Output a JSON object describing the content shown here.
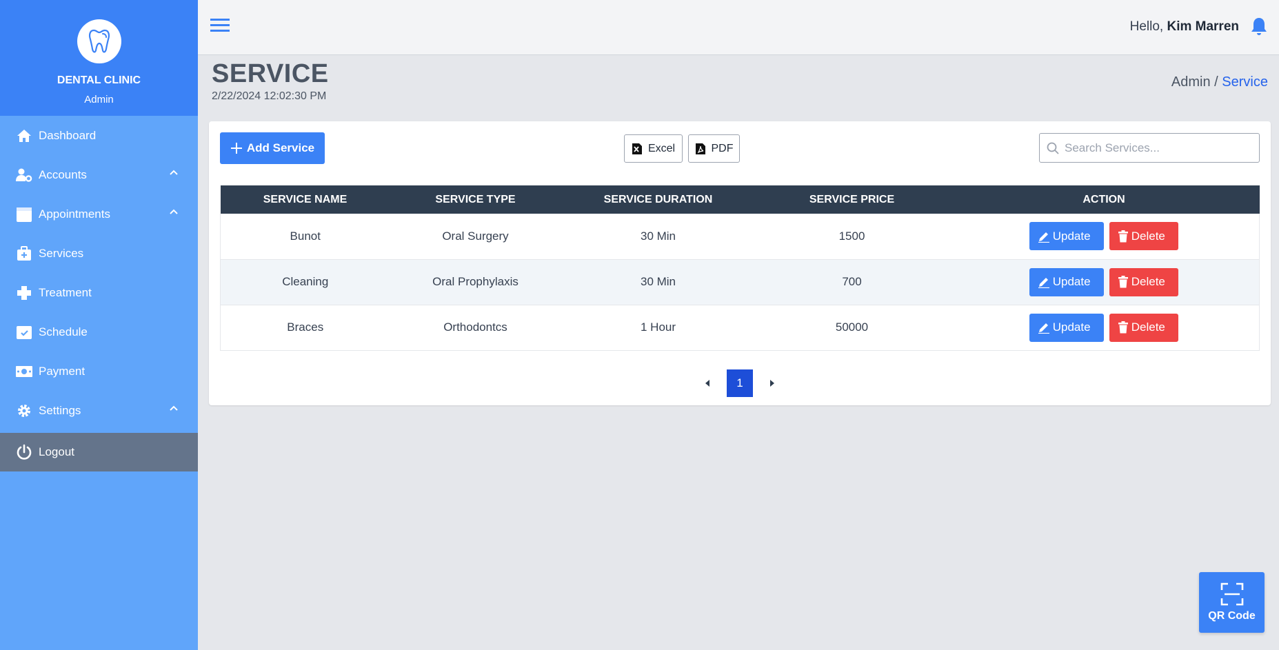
{
  "sidebar": {
    "brand_name": "DENTAL CLINIC",
    "brand_role": "Admin",
    "items": [
      {
        "label": "Dashboard",
        "icon": "home-icon"
      },
      {
        "label": "Accounts",
        "icon": "user-cog-icon",
        "expandable": true
      },
      {
        "label": "Appointments",
        "icon": "calendar-icon",
        "expandable": true
      },
      {
        "label": "Services",
        "icon": "medical-kit-icon"
      },
      {
        "label": "Treatment",
        "icon": "plus-cross-icon"
      },
      {
        "label": "Schedule",
        "icon": "calendar-check-icon"
      },
      {
        "label": "Payment",
        "icon": "money-icon"
      },
      {
        "label": "Settings",
        "icon": "gear-icon",
        "expandable": true
      }
    ],
    "logout_label": "Logout"
  },
  "header": {
    "greeting_prefix": "Hello, ",
    "user_name": "Kim Marren"
  },
  "page": {
    "title": "SERVICE",
    "datetime": "2/22/2024 12:02:30 PM",
    "breadcrumb_root": "Admin",
    "breadcrumb_sep": " / ",
    "breadcrumb_current": "Service"
  },
  "toolbar": {
    "add_label": "Add Service",
    "excel_label": "Excel",
    "pdf_label": "PDF",
    "search_placeholder": "Search Services..."
  },
  "table": {
    "columns": [
      "SERVICE NAME",
      "SERVICE TYPE",
      "SERVICE DURATION",
      "SERVICE PRICE",
      "ACTION"
    ],
    "rows": [
      {
        "name": "Bunot",
        "type": "Oral Surgery",
        "duration": "30 Min",
        "price": "1500"
      },
      {
        "name": "Cleaning",
        "type": "Oral Prophylaxis",
        "duration": "30 Min",
        "price": "700"
      },
      {
        "name": "Braces",
        "type": "Orthodontcs",
        "duration": "1 Hour",
        "price": "50000"
      }
    ],
    "update_label": "Update",
    "delete_label": "Delete"
  },
  "pagination": {
    "current": "1"
  },
  "qr": {
    "label": "QR Code"
  },
  "colors": {
    "primary": "#3b82f6",
    "sidebar": "#60a5fa",
    "danger": "#ef4444",
    "table_head": "#2f3e50"
  }
}
